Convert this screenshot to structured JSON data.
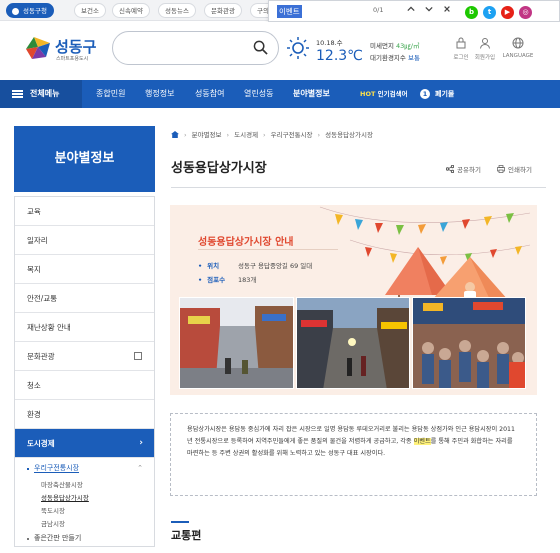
{
  "topbar": {
    "tabs": [
      {
        "label": "성동구청",
        "active": true
      },
      {
        "label": "보건소"
      },
      {
        "label": "신속예약"
      },
      {
        "label": "성동뉴스"
      },
      {
        "label": "문화관광"
      },
      {
        "label": "구의"
      }
    ]
  },
  "findbar": {
    "query": "이벤트",
    "count": "0/1",
    "prev_icon": "chevron-up-icon",
    "next_icon": "chevron-down-icon",
    "close_icon": "close-icon",
    "social": [
      {
        "name": "blog-icon",
        "glyph": "b",
        "color": "#1ec800"
      },
      {
        "name": "twitter-icon",
        "glyph": "t",
        "color": "#1da1f2"
      },
      {
        "name": "youtube-icon",
        "glyph": "▶",
        "color": "#e62117"
      },
      {
        "name": "instagram-icon",
        "glyph": "◎",
        "color": "#c13584"
      }
    ]
  },
  "header": {
    "logo": "성동구",
    "logo_sub": "스마트포용도시",
    "search_placeholder": "",
    "weather": {
      "date": "10.18.수",
      "temp": "12.3℃"
    },
    "dust": {
      "label": "미세먼지",
      "value": "43㎍/㎥",
      "env_label": "대기환경지수",
      "env_value": "보통"
    },
    "util": [
      {
        "icon": "lock-icon",
        "label": "로그인"
      },
      {
        "icon": "person-icon",
        "label": "회원가입"
      },
      {
        "icon": "globe-icon",
        "label": "LANGUAGE"
      }
    ]
  },
  "nav": {
    "all": "전체메뉴",
    "items": [
      "종합민원",
      "행정정보",
      "성동참여",
      "열린성동",
      "분야별정보"
    ],
    "active": "분야별정보",
    "hot_label": "HOT",
    "hot_text": "인기검색어",
    "rank_num": "1",
    "rank_word": "폐기물"
  },
  "sidebar": {
    "title": "분야별정보",
    "items": [
      "교육",
      "일자리",
      "복지",
      "안전/교통",
      "재난상황 안내",
      "문화관광",
      "청소",
      "환경",
      "도시경제"
    ],
    "active": "도시경제",
    "sub": "우리구전통시장",
    "subsub": [
      "마장축산물시장",
      "성동용답상가시장",
      "뚝도시장",
      "금남시장"
    ],
    "subsub_active": "성동용답상가시장",
    "next": "좋은간판 만들기"
  },
  "content": {
    "breadcrumb": [
      "분야별정보",
      "도시경제",
      "우리구전통시장",
      "성동용답상가시장"
    ],
    "title": "성동용답상가시장",
    "share": "공유하기",
    "print": "인쇄하기",
    "banner": {
      "title": "성동용답상가시장 안내",
      "rows": [
        {
          "k": "위치",
          "v": "성동구 용답중앙길 69 일대"
        },
        {
          "k": "점포수",
          "v": "183개"
        }
      ]
    },
    "desc_before": "용답상가시장은 용답동 중심가에 자리 잡은 시장으로 일명 용답동 루데오거리로 불리는 용답동 상점가와 인근 용답시장이 2011년 전통시장으로 등록하여 지역주민들에게 좋은 품질의 물건을 저렴하게 공급하고, 각종 ",
    "desc_highlight": "이벤트",
    "desc_after": "를 통해 주민과 화합하는 자리를 마련하는 등 주변 상권의 활성화를 위해 노력하고 있는 성동구 대표 시장이다.",
    "section": "교통편"
  }
}
